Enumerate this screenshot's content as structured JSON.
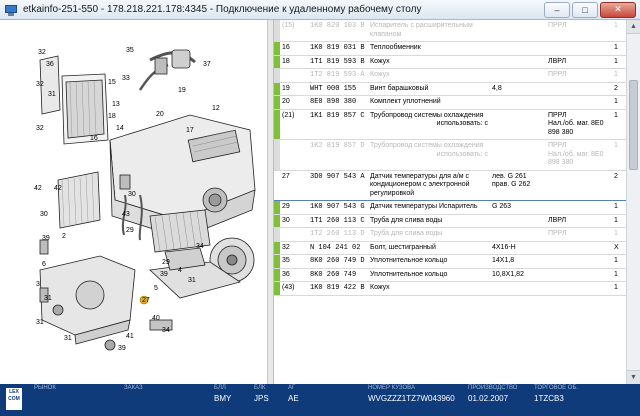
{
  "window": {
    "title": "etkainfo-251-550 - 178.218.221.178:4345 - Подключение к удаленному рабочему столу"
  },
  "diagram_callouts": [
    "32",
    "36",
    "37",
    "32",
    "35",
    "33",
    "32",
    "31",
    "19",
    "16",
    "18",
    "12",
    "15",
    "13",
    "14",
    "20",
    "17",
    "42",
    "42",
    "30",
    "30",
    "43",
    "29",
    "39",
    "2",
    "6",
    "3",
    "31",
    "5",
    "27",
    "29",
    "39",
    "31",
    "4",
    "34",
    "31",
    "40",
    "34",
    "41",
    "39",
    "31"
  ],
  "parts": [
    {
      "pos": "(15)",
      "num": "1K0 820 103 B",
      "name": "Испаритель с расширительным клапаном",
      "note": "",
      "extra": "ПРРЛ",
      "qty": "1",
      "dim": true,
      "mark": "gray"
    },
    {
      "pos": "16",
      "num": "1K0 819 031 B",
      "name": "Теплообменник",
      "note": "",
      "extra": "",
      "qty": "1",
      "dim": false,
      "mark": "green"
    },
    {
      "pos": "18",
      "num": "1T1 819 593 B",
      "name": "Кожух",
      "note": "",
      "extra": "ЛВРЛ",
      "qty": "1",
      "dim": false,
      "mark": "green"
    },
    {
      "pos": "",
      "num": "1T2 819 593 A",
      "name": "Кожух",
      "note": "",
      "extra": "ПРРЛ",
      "qty": "1",
      "dim": true,
      "mark": "gray"
    },
    {
      "pos": "19",
      "num": "WHT 000 155",
      "name": "Винт барашковый",
      "note": "4,8",
      "extra": "",
      "qty": "2",
      "dim": false,
      "mark": "green"
    },
    {
      "pos": "20",
      "num": "8E0 898 380",
      "name": "Комплект уплотнений",
      "note": "",
      "extra": "",
      "qty": "1",
      "dim": false,
      "mark": "green"
    },
    {
      "pos": "(21)",
      "num": "1K1 819 857 C",
      "name": "Трубопровод системы охлаждения",
      "note": "",
      "extra": "ПРРЛ",
      "qty": "1",
      "dim": false,
      "mark": "green",
      "sub": "использовать: с",
      "sub_extra": "Нал./об. маг. 8E0 898 380"
    },
    {
      "pos": "",
      "num": "1K2 819 857 D",
      "name": "Трубопровод системы охлаждения",
      "note": "",
      "extra": "ПРРЛ",
      "qty": "1",
      "dim": true,
      "mark": "gray",
      "sub": "использовать: с",
      "sub_extra": "Нал./об. маг. 8E0 898 380"
    },
    {
      "pos": "27",
      "num": "3D0 907 543 A",
      "name": "Датчик температуры для а/м с кондиционером с электронной регулировкой",
      "note": "лев. G 261 прав. G 262",
      "extra": "",
      "qty": "2",
      "dim": false,
      "mark": "none",
      "boxed": true
    },
    {
      "pos": "29",
      "num": "1K0 907 543 G",
      "name": "Датчик температуры Испаритель",
      "note": "G 263",
      "extra": "",
      "qty": "1",
      "dim": false,
      "mark": "green"
    },
    {
      "pos": "30",
      "num": "1T1 260 113 C",
      "name": "Труба для слива воды",
      "note": "",
      "extra": "ЛВРЛ",
      "qty": "1",
      "dim": false,
      "mark": "green"
    },
    {
      "pos": "",
      "num": "1T2 260 113 D",
      "name": "Труба для слива воды",
      "note": "",
      "extra": "ПРРЛ",
      "qty": "1",
      "dim": true,
      "mark": "gray"
    },
    {
      "pos": "32",
      "num": "N 104 241 02",
      "name": "Болт, шестигранный",
      "note": "4X16-H",
      "extra": "",
      "qty": "X",
      "dim": false,
      "mark": "green"
    },
    {
      "pos": "35",
      "num": "8K0 260 749 D",
      "name": "Уплотнительное кольцо",
      "note": "14X1,8",
      "extra": "",
      "qty": "1",
      "dim": false,
      "mark": "green"
    },
    {
      "pos": "36",
      "num": "8K0 260 749",
      "name": "Уплотнительное кольцо",
      "note": "10,8X1,82",
      "extra": "",
      "qty": "1",
      "dim": false,
      "mark": "green"
    },
    {
      "pos": "(43)",
      "num": "1K0 819 422 B",
      "name": "Кожух",
      "note": "",
      "extra": "",
      "qty": "1",
      "dim": false,
      "mark": "green"
    }
  ],
  "status": {
    "logo": "LEX COM",
    "cells": [
      {
        "head": "РЫНОК",
        "val": ""
      },
      {
        "head": "ЗАКАЗ",
        "val": ""
      },
      {
        "head": "БЛЛ",
        "val": "BMY"
      },
      {
        "head": "БЛК",
        "val": "JPS"
      },
      {
        "head": "АГ",
        "val": "AE"
      },
      {
        "head": "НОМЕР КУЗОВА",
        "val": "WVGZZZ1TZ7W043960"
      },
      {
        "head": "ПРОИЗВОДСТВО",
        "val": "01.02.2007"
      },
      {
        "head": "ТОРГОВОЕ ОБ.",
        "val": "1TZCB3"
      }
    ]
  }
}
